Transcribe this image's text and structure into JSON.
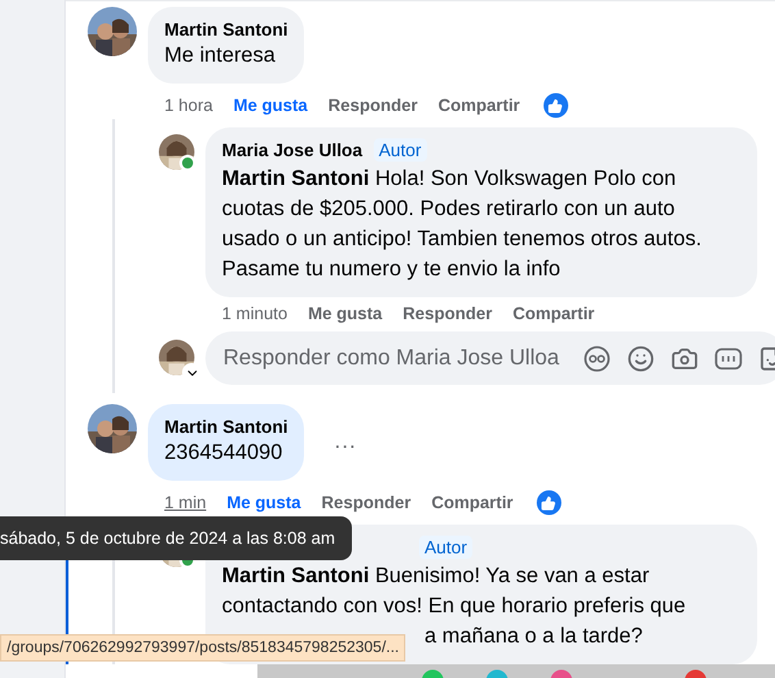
{
  "comments": [
    {
      "author": "Martin Santoni",
      "text": "Me interesa",
      "highlighted": false,
      "time": "1 hora",
      "time_hovered": false,
      "like": "Me gusta",
      "liked": true,
      "reply": "Responder",
      "share": "Compartir",
      "reacted": true,
      "replies": [
        {
          "author": "Maria Jose Ulloa",
          "badge": "Autor",
          "online": true,
          "text": "**Martin Santoni** Hola! Son Volkswagen Polo con cuotas de $205.000. Podes retirarlo con un auto usado o un anticipo! Tambien tenemos otros autos. Pasame tu numero y te envio la info",
          "time": "1 minuto",
          "like": "Me gusta",
          "liked": false,
          "reply": "Responder",
          "share": "Compartir"
        }
      ],
      "composer": {
        "placeholder": "Responder como Maria Jose Ulloa"
      }
    },
    {
      "author": "Martin Santoni",
      "text": "2364544090",
      "highlighted": true,
      "time": "1 min",
      "time_hovered": true,
      "like": "Me gusta",
      "liked": true,
      "reply": "Responder",
      "share": "Compartir",
      "reacted": true,
      "menu": "...",
      "replies": [
        {
          "badge": "Autor",
          "online": true,
          "text": "**Martin Santoni** Buenisimo! Ya se van a estar contactando con vos! En que horario preferis que",
          "text_tail": "a mañana o a la tarde?"
        }
      ]
    }
  ],
  "tooltip": {
    "text": "sábado, 5 de octubre de 2024 a las 8:08 am"
  },
  "status_bar": {
    "url": "/groups/706262992793997/posts/8518345798252305/..."
  }
}
